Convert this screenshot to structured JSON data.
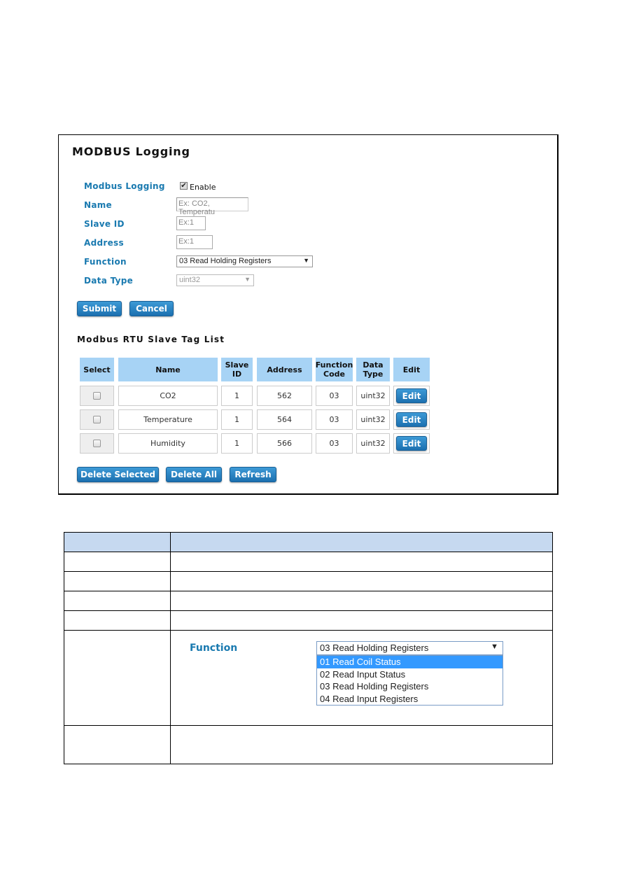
{
  "panel": {
    "title": "MODBUS Logging",
    "form": {
      "modbus_logging_label": "Modbus Logging",
      "enable_label": "Enable",
      "enable_checked": true,
      "name_label": "Name",
      "name_placeholder": "Ex: CO2, Temperatu",
      "slave_id_label": "Slave ID",
      "slave_id_placeholder": "Ex:1",
      "address_label": "Address",
      "address_placeholder": "Ex:1",
      "function_label": "Function",
      "function_value": "03 Read Holding Registers",
      "data_type_label": "Data Type",
      "data_type_value": "uint32"
    },
    "buttons": {
      "submit": "Submit",
      "cancel": "Cancel"
    },
    "tag_list": {
      "title": "Modbus RTU Slave Tag List",
      "headers": [
        "Select",
        "Name",
        "Slave\nID",
        "Address",
        "Function\nCode",
        "Data\nType",
        "Edit"
      ],
      "rows": [
        {
          "name": "CO2",
          "slave_id": "1",
          "address": "562",
          "function_code": "03",
          "data_type": "uint32",
          "edit": "Edit"
        },
        {
          "name": "Temperature",
          "slave_id": "1",
          "address": "564",
          "function_code": "03",
          "data_type": "uint32",
          "edit": "Edit"
        },
        {
          "name": "Humidity",
          "slave_id": "1",
          "address": "566",
          "function_code": "03",
          "data_type": "uint32",
          "edit": "Edit"
        }
      ]
    },
    "bottom_buttons": {
      "delete_selected": "Delete Selected",
      "delete_all": "Delete All",
      "refresh": "Refresh"
    }
  },
  "description_table": {
    "function_example": {
      "label": "Function",
      "selected": "03 Read Holding Registers",
      "options": [
        "01 Read Coil Status",
        "02 Read Input Status",
        "03 Read Holding Registers",
        "04 Read Input Registers"
      ],
      "highlighted_index": 0
    }
  },
  "colors": {
    "label_blue": "#1a7ab0",
    "button_blue": "#1c70b0",
    "header_blue": "#a7d3f5",
    "desc_header": "#c6d9f0"
  }
}
